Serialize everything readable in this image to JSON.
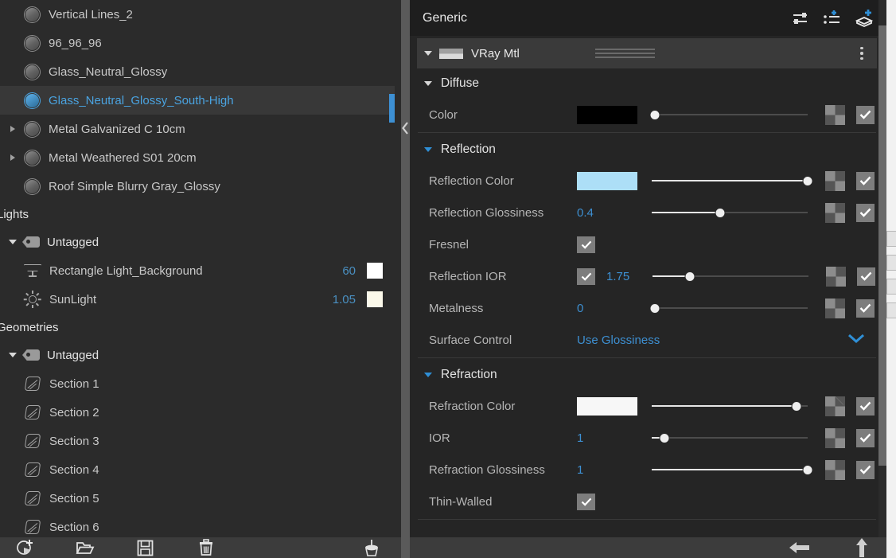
{
  "left_panel": {
    "materials": [
      {
        "label": "Vertical Lines_2",
        "expandable": false,
        "selected": false
      },
      {
        "label": "96_96_96",
        "expandable": false,
        "selected": false
      },
      {
        "label": "Glass_Neutral_Glossy",
        "expandable": false,
        "selected": false
      },
      {
        "label": "Glass_Neutral_Glossy_South-High",
        "expandable": false,
        "selected": true
      },
      {
        "label": "Metal Galvanized C 10cm",
        "expandable": true,
        "selected": false
      },
      {
        "label": "Metal Weathered S01 20cm",
        "expandable": true,
        "selected": false
      },
      {
        "label": "Roof Simple Blurry Gray_Glossy",
        "expandable": false,
        "selected": false
      }
    ],
    "lights_section": {
      "title": "Lights",
      "group": "Untagged",
      "items": [
        {
          "label": "Rectangle Light_Background",
          "icon": "rectangle-light-icon",
          "value": "60",
          "color": "#ffffff"
        },
        {
          "label": "SunLight",
          "icon": "sun-icon",
          "value": "1.05",
          "color": "#fbf9ea"
        }
      ]
    },
    "geometries_section": {
      "title": "Geometries",
      "group": "Untagged",
      "items": [
        {
          "label": "Section 1"
        },
        {
          "label": "Section 2"
        },
        {
          "label": "Section 3"
        },
        {
          "label": "Section 4"
        },
        {
          "label": "Section 5"
        },
        {
          "label": "Section 6"
        }
      ]
    },
    "toolbar": [
      {
        "name": "add-material-button",
        "icon": "sphere-plus-icon"
      },
      {
        "name": "open-folder-button",
        "icon": "folder-icon"
      },
      {
        "name": "save-button",
        "icon": "floppy-disk-icon"
      },
      {
        "name": "delete-button",
        "icon": "trash-icon"
      },
      {
        "name": "purge-button",
        "icon": "brush-icon"
      }
    ]
  },
  "right_panel": {
    "title": "Generic",
    "header_icons": [
      {
        "name": "render-settings-icon",
        "label": "sliders-icon"
      },
      {
        "name": "add-list-icon",
        "label": "add-to-list-icon"
      },
      {
        "name": "add-layer-icon",
        "label": "add-layer-icon"
      }
    ],
    "material": {
      "name": "VRay Mtl",
      "expanded": true,
      "menu": "kebab-menu-icon"
    },
    "groups": [
      {
        "name": "Diffuse",
        "accent": false,
        "params": [
          {
            "label": "Color",
            "type": "color",
            "color": "#000000",
            "slider": 0,
            "has_texture_slot": true,
            "enabled": true
          }
        ]
      },
      {
        "name": "Reflection",
        "accent": true,
        "params": [
          {
            "label": "Reflection Color",
            "type": "color",
            "color": "#addff7",
            "slider": 100,
            "has_texture_slot": true,
            "enabled": true
          },
          {
            "label": "Reflection Glossiness",
            "type": "number",
            "value": "0.4",
            "slider": 40,
            "has_texture_slot": true,
            "enabled": true
          },
          {
            "label": "Fresnel",
            "type": "checkbox",
            "checked": true
          },
          {
            "label": "Reflection IOR",
            "type": "checkbox-number",
            "checked": true,
            "value": "1.75",
            "slider": 22,
            "has_texture_slot": true,
            "enabled": true
          },
          {
            "label": "Metalness",
            "type": "number",
            "value": "0",
            "slider": 0,
            "has_texture_slot": true,
            "enabled": true
          },
          {
            "label": "Surface Control",
            "type": "dropdown",
            "value": "Use Glossiness"
          }
        ]
      },
      {
        "name": "Refraction",
        "accent": true,
        "params": [
          {
            "label": "Refraction Color",
            "type": "color",
            "color": "#f7f7f7",
            "slider": 95,
            "has_texture_slot": true,
            "enabled": true
          },
          {
            "label": "IOR",
            "type": "number",
            "value": "1",
            "slider": 7,
            "has_texture_slot": true,
            "enabled": true
          },
          {
            "label": "Refraction Glossiness",
            "type": "number",
            "value": "1",
            "slider": 100,
            "has_texture_slot": true,
            "enabled": true
          },
          {
            "label": "Thin-Walled",
            "type": "checkbox",
            "checked": true
          }
        ]
      }
    ],
    "toolbar": [
      {
        "name": "back-button",
        "icon": "arrow-left-icon"
      },
      {
        "name": "up-button",
        "icon": "arrow-up-icon"
      }
    ]
  },
  "colors": {
    "accent_blue": "#3d8fd1",
    "selection_blue": "#4aa3e0",
    "panel_bg": "#252525",
    "sidebar_bg": "#2b2b2b"
  }
}
